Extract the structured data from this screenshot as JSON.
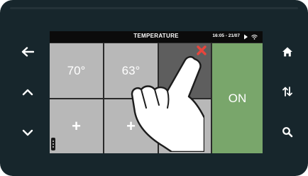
{
  "header": {
    "title": "TEMPERATURE",
    "datetime": "16:05 - 21/07"
  },
  "presets": [
    {
      "label": "70°"
    },
    {
      "label": "63°"
    },
    {
      "label": ""
    }
  ],
  "add_slots": [
    "+",
    "+",
    "+"
  ],
  "power": {
    "label": "ON"
  },
  "icons": {
    "left": [
      "arrow-left-icon",
      "chevron-up-icon",
      "chevron-down-icon"
    ],
    "right": [
      "home-icon",
      "sort-arrows-icon",
      "search-icon"
    ],
    "status": [
      "play-icon",
      "wifi-icon"
    ]
  },
  "colors": {
    "bezel": "#17262c",
    "tile": "#b8b8b8",
    "tile_selected": "#5e5e5e",
    "on": "#79a66b",
    "delete": "#e8453c"
  }
}
